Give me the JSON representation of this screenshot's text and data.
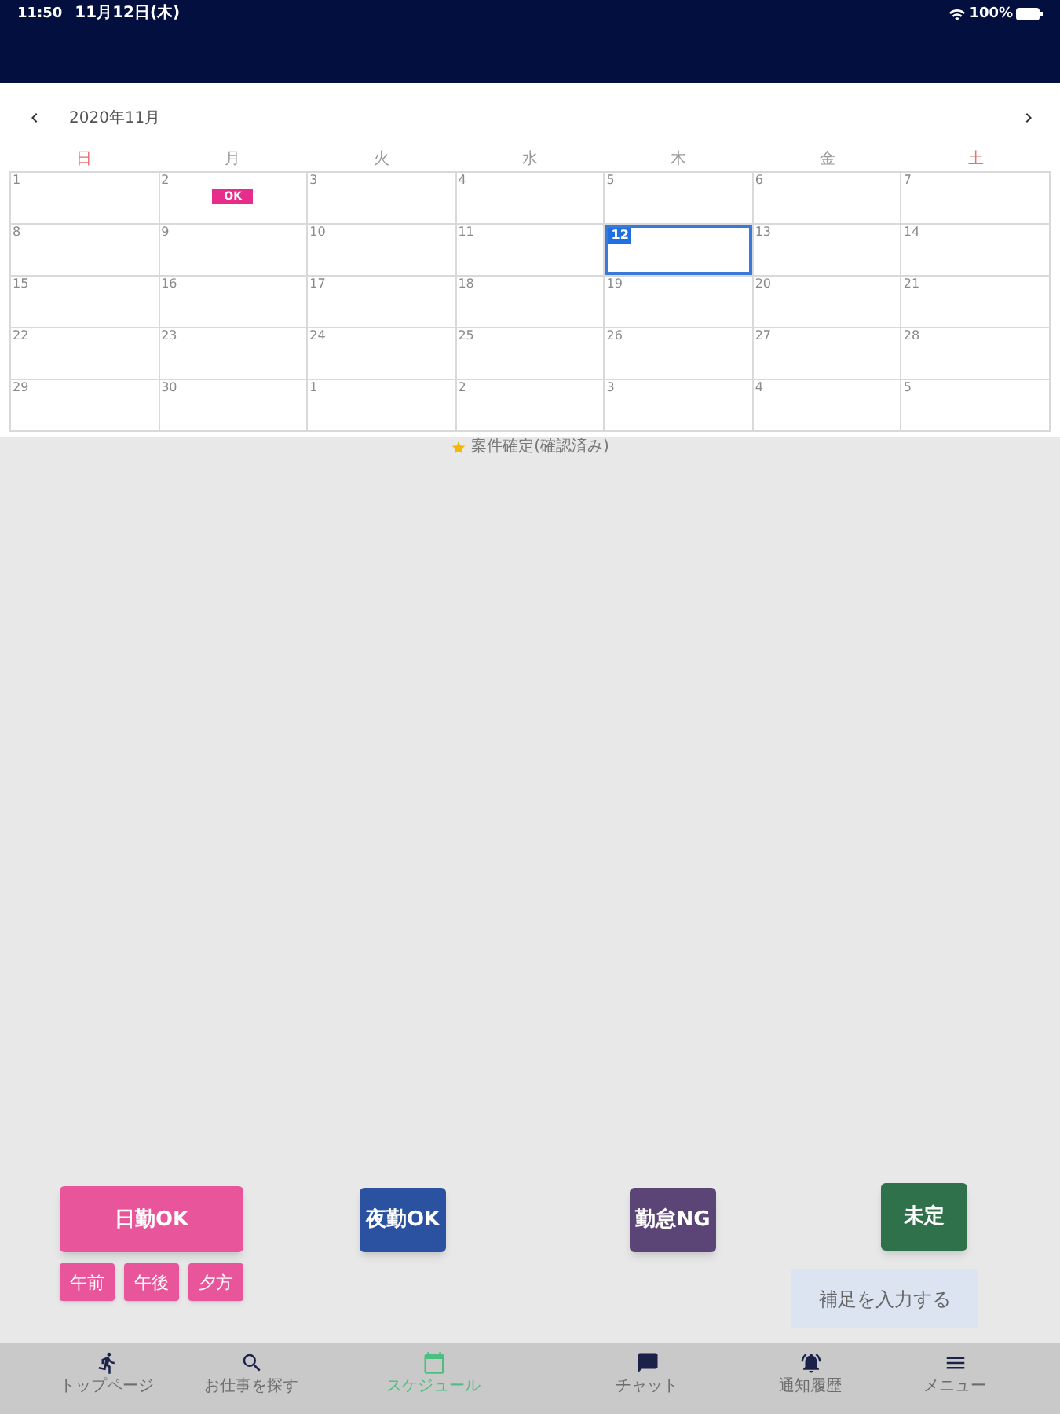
{
  "status_bar": {
    "time": "11:50",
    "date": "11月12日(木)",
    "battery": "100%"
  },
  "calendar": {
    "month": "2020年11月",
    "weekdays": [
      {
        "label": "日",
        "color": "#e8716b"
      },
      {
        "label": "月",
        "color": "#9a9a9a"
      },
      {
        "label": "火",
        "color": "#9a9a9a"
      },
      {
        "label": "水",
        "color": "#9a9a9a"
      },
      {
        "label": "木",
        "color": "#9a9a9a"
      },
      {
        "label": "金",
        "color": "#9a9a9a"
      },
      {
        "label": "土",
        "color": "#e8716b"
      }
    ],
    "weeks": [
      [
        {
          "day": "1",
          "selected": false
        },
        {
          "day": "2",
          "selected": false,
          "badge": "OK"
        },
        {
          "day": "3",
          "selected": false
        },
        {
          "day": "4",
          "selected": false
        },
        {
          "day": "5",
          "selected": false
        },
        {
          "day": "6",
          "selected": false
        },
        {
          "day": "7",
          "selected": false
        }
      ],
      [
        {
          "day": "8",
          "selected": false
        },
        {
          "day": "9",
          "selected": false
        },
        {
          "day": "10",
          "selected": false
        },
        {
          "day": "11",
          "selected": false
        },
        {
          "day": "12",
          "selected": true
        },
        {
          "day": "13",
          "selected": false
        },
        {
          "day": "14",
          "selected": false
        }
      ],
      [
        {
          "day": "15",
          "selected": false
        },
        {
          "day": "16",
          "selected": false
        },
        {
          "day": "17",
          "selected": false
        },
        {
          "day": "18",
          "selected": false
        },
        {
          "day": "19",
          "selected": false
        },
        {
          "day": "20",
          "selected": false
        },
        {
          "day": "21",
          "selected": false
        }
      ],
      [
        {
          "day": "22",
          "selected": false
        },
        {
          "day": "23",
          "selected": false
        },
        {
          "day": "24",
          "selected": false
        },
        {
          "day": "25",
          "selected": false
        },
        {
          "day": "26",
          "selected": false
        },
        {
          "day": "27",
          "selected": false
        },
        {
          "day": "28",
          "selected": false
        }
      ],
      [
        {
          "day": "29",
          "selected": false
        },
        {
          "day": "30",
          "selected": false
        },
        {
          "day": "1",
          "selected": false
        },
        {
          "day": "2",
          "selected": false
        },
        {
          "day": "3",
          "selected": false
        },
        {
          "day": "4",
          "selected": false
        },
        {
          "day": "5",
          "selected": false
        }
      ]
    ]
  },
  "legend": {
    "label": "案件確定(確認済み)"
  },
  "actions": [
    {
      "label": "日勤OK",
      "color": "#e8559a",
      "slots": [
        "午前",
        "午後",
        "夕方"
      ]
    },
    {
      "label": "夜勤OK",
      "color": "#2b52a1"
    },
    {
      "label": "勤怠NG",
      "color": "#5b4577"
    },
    {
      "label": "未定",
      "color": "#2f714a"
    }
  ],
  "note_button": {
    "label": "補足を入力する"
  },
  "tab_bar": [
    {
      "label": "トップページ",
      "selected": false
    },
    {
      "label": "お仕事を探す",
      "selected": false
    },
    {
      "label": "スケジュール",
      "selected": true
    },
    {
      "label": "チャット",
      "selected": false
    },
    {
      "label": "通知履歴",
      "selected": false
    },
    {
      "label": "メニュー",
      "selected": false
    }
  ]
}
